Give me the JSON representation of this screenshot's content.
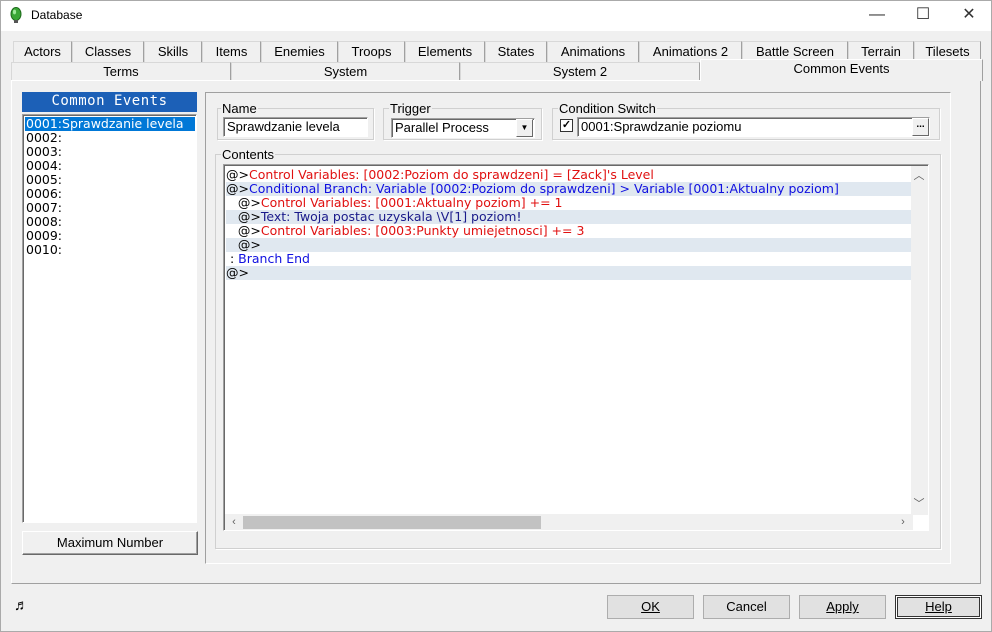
{
  "window": {
    "title": "Database",
    "controls": {
      "minimize": "—",
      "maximize": "☐",
      "close": "✕"
    }
  },
  "tabs_row1": [
    "Actors",
    "Classes",
    "Skills",
    "Items",
    "Enemies",
    "Troops",
    "Elements",
    "States",
    "Animations",
    "Animations 2",
    "Battle Screen",
    "Terrain",
    "Tilesets"
  ],
  "tabs_row2": [
    "Terms",
    "System",
    "System 2",
    "Common Events"
  ],
  "active_tab": "Common Events",
  "common_events": {
    "header": "Common Events",
    "items": [
      "0001:Sprawdzanie levela",
      "0002:",
      "0003:",
      "0004:",
      "0005:",
      "0006:",
      "0007:",
      "0008:",
      "0009:",
      "0010:"
    ],
    "selected_index": 0,
    "max_button": "Maximum Number"
  },
  "name": {
    "label": "Name",
    "value": "Sprawdzanie levela"
  },
  "trigger": {
    "label": "Trigger",
    "value": "Parallel Process"
  },
  "condition_switch": {
    "label": "Condition Switch",
    "checked": true,
    "checkmark": "✓",
    "value": "0001:Sprawdzanie poziomu",
    "browse": "..."
  },
  "contents": {
    "label": "Contents",
    "lines": [
      {
        "prefix": "@>",
        "text": "Control Variables: [0002:Poziom do sprawdzeni] = [Zack]'s Level",
        "color": "red"
      },
      {
        "prefix": "@>",
        "text": "Conditional Branch: Variable [0002:Poziom do sprawdzeni] > Variable [0001:Aktualny poziom]",
        "color": "blue"
      },
      {
        "prefix": "   @>",
        "text": "Control Variables: [0001:Aktualny poziom] += 1",
        "color": "red"
      },
      {
        "prefix": "   @>",
        "text": "Text: Twoja postac uzyskala \\V[1] poziom!",
        "color": "navy"
      },
      {
        "prefix": "   @>",
        "text": "Control Variables: [0003:Punkty umiejetnosci] += 3",
        "color": "red"
      },
      {
        "prefix": "   @>",
        "text": "",
        "color": "blk"
      },
      {
        "prefix": " : ",
        "text": "Branch End",
        "color": "blue"
      },
      {
        "prefix": "@>",
        "text": "",
        "color": "blk"
      }
    ]
  },
  "buttons": {
    "ok": "OK",
    "cancel": "Cancel",
    "apply": "Apply",
    "help": "Help"
  },
  "status_icon": "♬"
}
